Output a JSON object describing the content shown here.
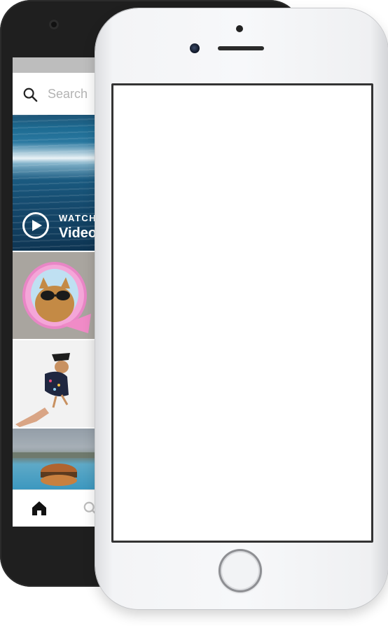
{
  "android_app": {
    "search": {
      "placeholder": "Search"
    },
    "video_tile": {
      "watch_label": "WATCH",
      "video_label": "Videos"
    },
    "icons": {
      "search": "search-icon",
      "play": "play-icon",
      "home": "home-icon",
      "search_tab": "search-icon"
    },
    "colors": {
      "status_bar": "#bdbdbd",
      "device_body": "#1f1f1f"
    }
  },
  "iphone": {
    "colors": {
      "body": "#f5f6f8",
      "screen": "#ffffff",
      "screen_border": "#333333"
    }
  }
}
